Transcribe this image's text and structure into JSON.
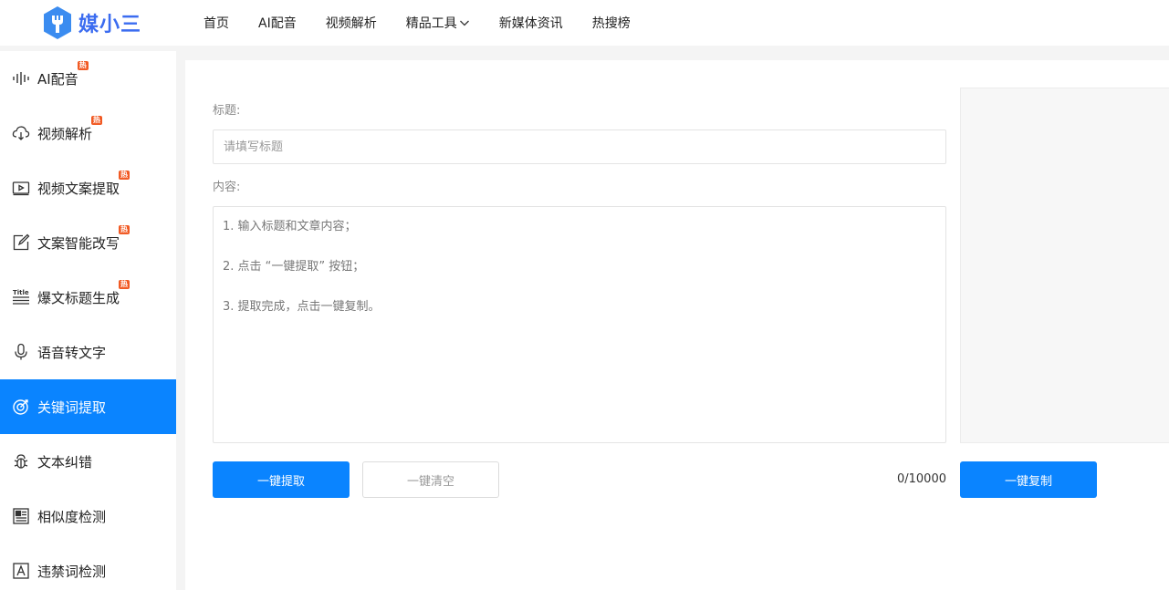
{
  "header": {
    "logo_text": "媒小三",
    "nav": [
      {
        "label": "首页"
      },
      {
        "label": "AI配音"
      },
      {
        "label": "视频解析"
      },
      {
        "label": "精品工具"
      },
      {
        "label": "新媒体资讯"
      },
      {
        "label": "热搜榜"
      }
    ]
  },
  "sidebar": {
    "items": [
      {
        "label": "AI配音",
        "icon": "waveform-icon",
        "hot": true
      },
      {
        "label": "视频解析",
        "icon": "cloud-download-icon",
        "hot": true
      },
      {
        "label": "视频文案提取",
        "icon": "video-play-icon",
        "hot": true
      },
      {
        "label": "文案智能改写",
        "icon": "edit-icon",
        "hot": true
      },
      {
        "label": "爆文标题生成",
        "icon": "title-icon",
        "hot": true
      },
      {
        "label": "语音转文字",
        "icon": "microphone-icon",
        "hot": false
      },
      {
        "label": "关键词提取",
        "icon": "target-icon",
        "hot": false,
        "active": true
      },
      {
        "label": "文本纠错",
        "icon": "bug-icon",
        "hot": false
      },
      {
        "label": "相似度检测",
        "icon": "document-compare-icon",
        "hot": false
      },
      {
        "label": "违禁词检测",
        "icon": "forbidden-text-icon",
        "hot": false
      }
    ],
    "hot_badge": "热"
  },
  "form": {
    "title_label": "标题:",
    "title_placeholder": "请填写标题",
    "content_label": "内容:",
    "content_lines": [
      "1. 输入标题和文章内容；",
      "2. 点击 “一键提取” 按钮；",
      "3. 提取完成，点击一键复制。"
    ],
    "extract_button": "一键提取",
    "clear_button": "一键清空",
    "counter": "0/10000",
    "copy_button": "一键复制"
  },
  "colors": {
    "accent": "#0a84ff",
    "hot_badge": "#f15a24",
    "logo": "#3b6cf0"
  }
}
